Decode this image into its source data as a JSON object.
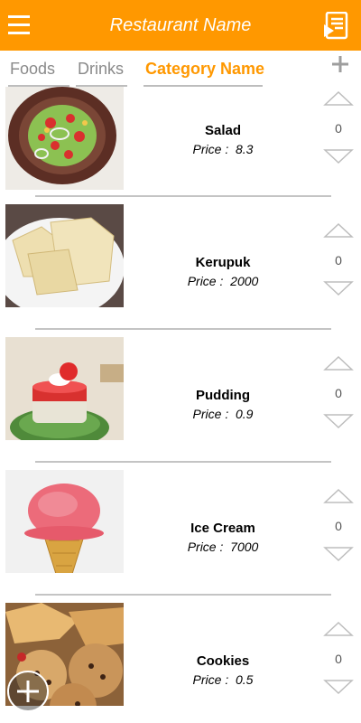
{
  "appbar": {
    "title": "Restaurant Name"
  },
  "tabs": [
    {
      "label": "Foods",
      "active": false
    },
    {
      "label": "Drinks",
      "active": false
    },
    {
      "label": "Category Name",
      "active": true
    }
  ],
  "colors": {
    "accent": "#ff9800",
    "inactive_tab": "#8a8a8a",
    "divider": "#c4c4c4"
  },
  "price_prefix": "Price :",
  "items": [
    {
      "name": "Salad",
      "price": "8.3",
      "quantity": "0"
    },
    {
      "name": "Kerupuk",
      "price": "2000",
      "quantity": "0"
    },
    {
      "name": "Pudding",
      "price": "0.9",
      "quantity": "0"
    },
    {
      "name": "Ice Cream",
      "price": "7000",
      "quantity": "0"
    },
    {
      "name": "Cookies",
      "price": "0.5",
      "quantity": "0"
    }
  ],
  "icons": {
    "menu": "hamburger-icon",
    "order": "order-list-icon",
    "add_category": "plus-icon",
    "increase": "triangle-up-icon",
    "decrease": "triangle-down-icon",
    "fab": "plus-circle-icon"
  }
}
